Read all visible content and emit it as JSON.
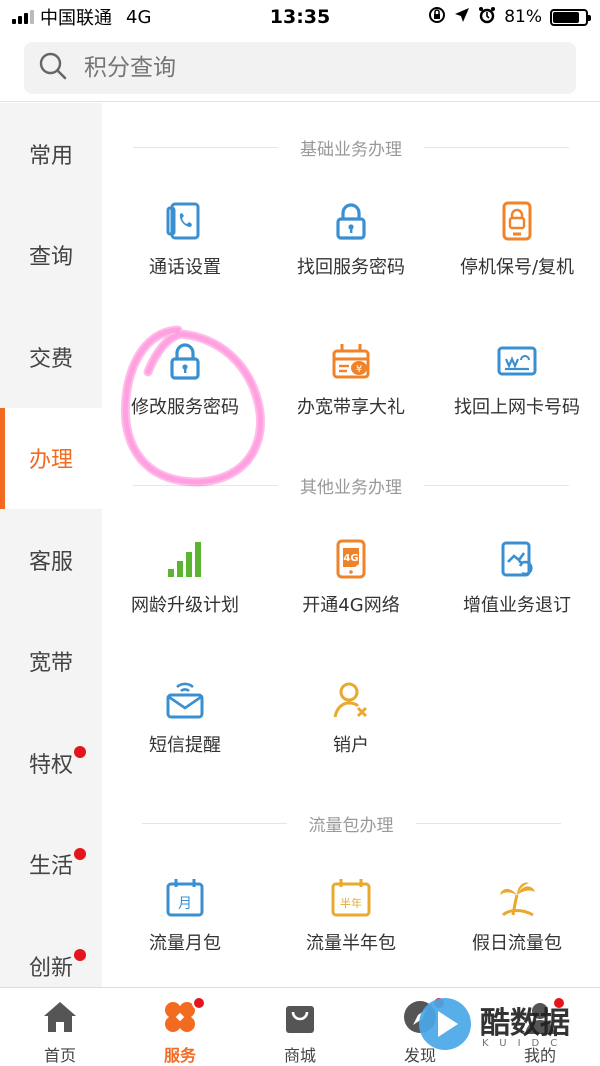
{
  "status": {
    "carrier": "中国联通",
    "network": "4G",
    "time": "13:35",
    "battery": "81%",
    "battery_level": 0.81
  },
  "search": {
    "placeholder": "积分查询"
  },
  "sidebar": {
    "items": [
      {
        "label": "常用",
        "dot": false
      },
      {
        "label": "查询",
        "dot": false
      },
      {
        "label": "交费",
        "dot": false
      },
      {
        "label": "办理",
        "dot": false,
        "active": true
      },
      {
        "label": "客服",
        "dot": false
      },
      {
        "label": "宽带",
        "dot": false
      },
      {
        "label": "特权",
        "dot": true
      },
      {
        "label": "生活",
        "dot": true
      },
      {
        "label": "创新",
        "dot": true
      }
    ]
  },
  "sections": [
    {
      "title": "基础业务办理",
      "items": [
        {
          "label": "通话设置",
          "icon": "call-settings-icon"
        },
        {
          "label": "找回服务密码",
          "icon": "lock-icon"
        },
        {
          "label": "停机保号/复机",
          "icon": "phone-lock-icon"
        },
        {
          "label": "修改服务密码",
          "icon": "lock-icon"
        },
        {
          "label": "办宽带享大礼",
          "icon": "broadband-gift-icon"
        },
        {
          "label": "找回上网卡号码",
          "icon": "sim-card-icon"
        }
      ]
    },
    {
      "title": "其他业务办理",
      "items": [
        {
          "label": "网龄升级计划",
          "icon": "signal-bars-icon"
        },
        {
          "label": "开通4G网络",
          "icon": "4g-phone-icon"
        },
        {
          "label": "增值业务退订",
          "icon": "unsubscribe-icon"
        },
        {
          "label": "短信提醒",
          "icon": "sms-reminder-icon"
        },
        {
          "label": "销户",
          "icon": "user-cancel-icon"
        }
      ]
    },
    {
      "title": "流量包办理",
      "items": [
        {
          "label": "流量月包",
          "icon": "calendar-month-icon"
        },
        {
          "label": "流量半年包",
          "icon": "calendar-half-year-icon"
        },
        {
          "label": "假日流量包",
          "icon": "beach-icon"
        }
      ]
    }
  ],
  "icon_texts": {
    "g4": "4G",
    "month": "月",
    "half_year": "半年"
  },
  "tabs": [
    {
      "label": "首页",
      "icon": "home-icon"
    },
    {
      "label": "服务",
      "icon": "service-icon",
      "active": true,
      "dot": true
    },
    {
      "label": "商城",
      "icon": "shop-bag-icon"
    },
    {
      "label": "发现",
      "icon": "discover-icon",
      "dot": true
    },
    {
      "label": "我的",
      "icon": "profile-icon",
      "dot": true
    }
  ],
  "watermark": {
    "text": "酷数据",
    "sub": "KUIDC"
  },
  "colors": {
    "accent": "#f26b21",
    "blue": "#3a8fd1",
    "orange": "#f0832a",
    "green": "#5cb531",
    "badge": "#e4151b",
    "annotation": "#ff3fbf"
  }
}
